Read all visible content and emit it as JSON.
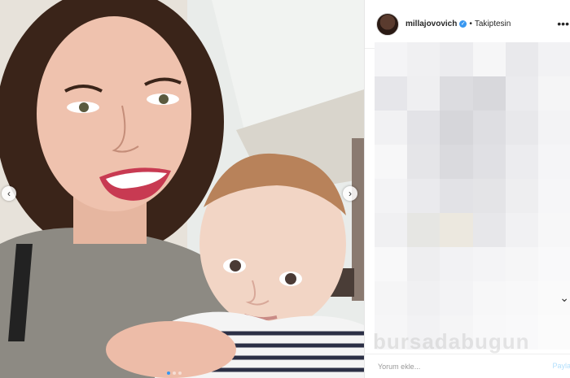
{
  "post": {
    "username": "millajovovich",
    "verified": true,
    "separator": "•",
    "follow_state": "Takiptesin",
    "more_icon": "more-horizontal-icon"
  },
  "photo": {
    "prev_icon": "chevron-left-icon",
    "next_icon": "chevron-right-icon",
    "slide_count": 3,
    "active_slide": 1
  },
  "comment": {
    "placeholder": "Yorum ekle...",
    "share_label": "Payla"
  },
  "watermark": "bursadabugun",
  "colors": {
    "link_blue": "#3897f0",
    "verified": "#3897f0",
    "share_disabled": "#b2dffc"
  }
}
